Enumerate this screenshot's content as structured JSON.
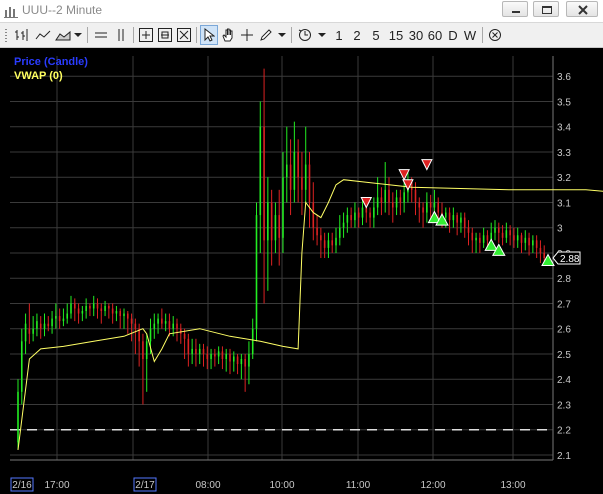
{
  "window": {
    "title": "UUU--2 Minute"
  },
  "toolbar": {
    "intervals": [
      "1",
      "2",
      "5",
      "15",
      "30",
      "60",
      "D",
      "W"
    ]
  },
  "legend": {
    "price": "Price (Candle)",
    "vwap": "VWAP (0)"
  },
  "colors": {
    "up": "#22ee22",
    "down": "#dd2222",
    "vwap": "#ffff66",
    "buy": "#33ee33",
    "sell": "#dd2222",
    "background": "#000000",
    "grid": "#3a3a3a"
  },
  "chart_data": {
    "type": "candlestick",
    "ylim": [
      2.08,
      3.68
    ],
    "y_ticks": [
      "3.6",
      "3.5",
      "3.4",
      "3.3",
      "3.2",
      "3.1",
      "3",
      "2.9",
      "2.8",
      "2.7",
      "2.6",
      "2.5",
      "2.4",
      "2.3",
      "2.2",
      "2.1"
    ],
    "x_ticks": [
      "2/16",
      "17:00",
      "2/17",
      "08:00",
      "10:00",
      "11:00",
      "12:00",
      "13:00"
    ],
    "last_price": "2.88",
    "reference_line": 2.2,
    "vwap": [
      [
        0,
        2.12
      ],
      [
        3,
        2.48
      ],
      [
        6,
        2.52
      ],
      [
        12,
        2.53
      ],
      [
        20,
        2.55
      ],
      [
        28,
        2.57
      ],
      [
        33,
        2.6
      ],
      [
        34,
        2.58
      ],
      [
        36,
        2.47
      ],
      [
        38,
        2.52
      ],
      [
        40,
        2.58
      ],
      [
        48,
        2.6
      ],
      [
        56,
        2.57
      ],
      [
        64,
        2.55
      ],
      [
        70,
        2.53
      ],
      [
        74,
        2.52
      ],
      [
        75,
        2.9
      ],
      [
        76,
        3.1
      ],
      [
        78,
        3.06
      ],
      [
        80,
        3.04
      ],
      [
        82,
        3.1
      ],
      [
        84,
        3.17
      ],
      [
        86,
        3.19
      ],
      [
        92,
        3.18
      ],
      [
        104,
        3.16
      ],
      [
        130,
        3.15
      ],
      [
        150,
        3.15
      ],
      [
        158,
        3.14
      ]
    ],
    "candles": [
      [
        0,
        2.15,
        2.35,
        2.12,
        2.4
      ],
      [
        1,
        2.35,
        2.55,
        2.3,
        2.6
      ],
      [
        2,
        2.55,
        2.62,
        2.5,
        2.66
      ],
      [
        3,
        2.6,
        2.58,
        2.54,
        2.7
      ],
      [
        4,
        2.58,
        2.6,
        2.55,
        2.65
      ],
      [
        5,
        2.6,
        2.63,
        2.57,
        2.66
      ],
      [
        6,
        2.62,
        2.6,
        2.56,
        2.65
      ],
      [
        7,
        2.6,
        2.62,
        2.57,
        2.66
      ],
      [
        8,
        2.62,
        2.61,
        2.59,
        2.65
      ],
      [
        9,
        2.61,
        2.64,
        2.58,
        2.67
      ],
      [
        10,
        2.64,
        2.65,
        2.6,
        2.7
      ],
      [
        11,
        2.65,
        2.63,
        2.6,
        2.68
      ],
      [
        12,
        2.63,
        2.64,
        2.61,
        2.68
      ],
      [
        13,
        2.64,
        2.66,
        2.62,
        2.7
      ],
      [
        14,
        2.66,
        2.7,
        2.64,
        2.73
      ],
      [
        15,
        2.7,
        2.68,
        2.63,
        2.72
      ],
      [
        16,
        2.68,
        2.66,
        2.62,
        2.7
      ],
      [
        17,
        2.66,
        2.67,
        2.63,
        2.69
      ],
      [
        18,
        2.67,
        2.69,
        2.64,
        2.72
      ],
      [
        19,
        2.69,
        2.68,
        2.65,
        2.7
      ],
      [
        20,
        2.68,
        2.7,
        2.65,
        2.73
      ],
      [
        21,
        2.7,
        2.68,
        2.64,
        2.72
      ],
      [
        22,
        2.68,
        2.67,
        2.62,
        2.7
      ],
      [
        23,
        2.67,
        2.69,
        2.65,
        2.71
      ],
      [
        24,
        2.69,
        2.68,
        2.64,
        2.7
      ],
      [
        25,
        2.68,
        2.66,
        2.62,
        2.7
      ],
      [
        26,
        2.66,
        2.67,
        2.63,
        2.69
      ],
      [
        27,
        2.67,
        2.65,
        2.6,
        2.68
      ],
      [
        28,
        2.65,
        2.66,
        2.6,
        2.68
      ],
      [
        29,
        2.66,
        2.64,
        2.58,
        2.67
      ],
      [
        30,
        2.64,
        2.62,
        2.55,
        2.66
      ],
      [
        31,
        2.62,
        2.6,
        2.5,
        2.64
      ],
      [
        32,
        2.6,
        2.55,
        2.45,
        2.62
      ],
      [
        33,
        2.55,
        2.48,
        2.3,
        2.58
      ],
      [
        34,
        2.48,
        2.55,
        2.35,
        2.58
      ],
      [
        35,
        2.55,
        2.6,
        2.5,
        2.64
      ],
      [
        36,
        2.6,
        2.62,
        2.56,
        2.66
      ],
      [
        37,
        2.62,
        2.64,
        2.58,
        2.66
      ],
      [
        38,
        2.64,
        2.62,
        2.6,
        2.68
      ],
      [
        39,
        2.62,
        2.63,
        2.59,
        2.66
      ],
      [
        40,
        2.63,
        2.6,
        2.57,
        2.66
      ],
      [
        41,
        2.6,
        2.62,
        2.57,
        2.65
      ],
      [
        42,
        2.62,
        2.6,
        2.55,
        2.64
      ],
      [
        43,
        2.6,
        2.58,
        2.54,
        2.62
      ],
      [
        44,
        2.58,
        2.56,
        2.48,
        2.6
      ],
      [
        45,
        2.56,
        2.5,
        2.45,
        2.58
      ],
      [
        46,
        2.5,
        2.52,
        2.46,
        2.56
      ],
      [
        47,
        2.52,
        2.5,
        2.45,
        2.56
      ],
      [
        48,
        2.5,
        2.52,
        2.46,
        2.54
      ],
      [
        49,
        2.52,
        2.5,
        2.45,
        2.54
      ],
      [
        50,
        2.5,
        2.48,
        2.44,
        2.53
      ],
      [
        51,
        2.48,
        2.5,
        2.44,
        2.52
      ],
      [
        52,
        2.5,
        2.49,
        2.45,
        2.52
      ],
      [
        53,
        2.49,
        2.51,
        2.46,
        2.53
      ],
      [
        54,
        2.51,
        2.48,
        2.44,
        2.53
      ],
      [
        55,
        2.48,
        2.5,
        2.43,
        2.52
      ],
      [
        56,
        2.5,
        2.47,
        2.42,
        2.52
      ],
      [
        57,
        2.47,
        2.49,
        2.43,
        2.51
      ],
      [
        58,
        2.49,
        2.46,
        2.42,
        2.5
      ],
      [
        59,
        2.46,
        2.48,
        2.4,
        2.5
      ],
      [
        60,
        2.48,
        2.45,
        2.35,
        2.5
      ],
      [
        61,
        2.45,
        2.5,
        2.38,
        2.55
      ],
      [
        62,
        2.5,
        2.6,
        2.48,
        2.64
      ],
      [
        63,
        2.6,
        3.05,
        2.55,
        3.1
      ],
      [
        64,
        3.05,
        3.4,
        2.9,
        3.5
      ],
      [
        65,
        3.4,
        2.95,
        2.7,
        3.63
      ],
      [
        66,
        2.95,
        3.1,
        2.75,
        3.2
      ],
      [
        67,
        3.1,
        2.95,
        2.85,
        3.15
      ],
      [
        68,
        2.95,
        3.05,
        2.9,
        3.1
      ],
      [
        69,
        3.05,
        2.96,
        2.85,
        3.15
      ],
      [
        70,
        2.96,
        3.2,
        2.9,
        3.3
      ],
      [
        71,
        3.2,
        3.25,
        3.1,
        3.4
      ],
      [
        72,
        3.25,
        3.15,
        3.05,
        3.35
      ],
      [
        73,
        3.15,
        3.3,
        3.1,
        3.42
      ],
      [
        74,
        3.3,
        3.2,
        3.1,
        3.35
      ],
      [
        75,
        3.2,
        3.15,
        3.05,
        3.3
      ],
      [
        76,
        3.15,
        3.25,
        3.1,
        3.4
      ],
      [
        77,
        3.25,
        3.1,
        3.0,
        3.3
      ],
      [
        78,
        3.1,
        3.0,
        2.95,
        3.18
      ],
      [
        79,
        3.0,
        2.97,
        2.93,
        3.05
      ],
      [
        80,
        2.97,
        2.95,
        2.88,
        3.0
      ],
      [
        81,
        2.95,
        2.92,
        2.88,
        2.98
      ],
      [
        82,
        2.92,
        2.95,
        2.88,
        2.98
      ],
      [
        83,
        2.95,
        2.93,
        2.9,
        2.98
      ],
      [
        84,
        2.93,
        2.96,
        2.9,
        3.0
      ],
      [
        85,
        2.96,
        3.0,
        2.93,
        3.05
      ],
      [
        86,
        3.0,
        3.02,
        2.96,
        3.06
      ],
      [
        87,
        3.02,
        3.05,
        2.98,
        3.08
      ],
      [
        88,
        3.05,
        3.03,
        3.0,
        3.08
      ],
      [
        89,
        3.03,
        3.06,
        3.0,
        3.1
      ],
      [
        90,
        3.06,
        3.04,
        3.0,
        3.08
      ],
      [
        91,
        3.04,
        3.08,
        3.01,
        3.12
      ],
      [
        92,
        3.08,
        3.06,
        3.02,
        3.1
      ],
      [
        93,
        3.06,
        3.04,
        3.0,
        3.08
      ],
      [
        94,
        3.04,
        3.08,
        3.0,
        3.12
      ],
      [
        95,
        3.08,
        3.12,
        3.05,
        3.2
      ],
      [
        96,
        3.12,
        3.1,
        3.05,
        3.16
      ],
      [
        97,
        3.1,
        3.15,
        3.06,
        3.26
      ],
      [
        98,
        3.15,
        3.1,
        3.05,
        3.2
      ],
      [
        99,
        3.1,
        3.08,
        3.02,
        3.14
      ],
      [
        100,
        3.08,
        3.12,
        3.05,
        3.15
      ],
      [
        101,
        3.12,
        3.1,
        3.05,
        3.15
      ],
      [
        102,
        3.1,
        3.14,
        3.06,
        3.2
      ],
      [
        103,
        3.14,
        3.18,
        3.1,
        3.22
      ],
      [
        104,
        3.18,
        3.15,
        3.1,
        3.2
      ],
      [
        105,
        3.15,
        3.1,
        3.05,
        3.18
      ],
      [
        106,
        3.1,
        3.08,
        3.02,
        3.12
      ],
      [
        107,
        3.08,
        3.06,
        3.0,
        3.1
      ],
      [
        108,
        3.06,
        3.1,
        3.02,
        3.14
      ],
      [
        109,
        3.1,
        3.08,
        3.04,
        3.13
      ],
      [
        110,
        3.08,
        3.1,
        3.05,
        3.15
      ],
      [
        111,
        3.1,
        3.06,
        3.02,
        3.12
      ],
      [
        112,
        3.06,
        3.04,
        3.0,
        3.1
      ],
      [
        113,
        3.04,
        3.06,
        3.0,
        3.08
      ],
      [
        114,
        3.06,
        3.03,
        2.98,
        3.08
      ],
      [
        115,
        3.03,
        3.05,
        3.0,
        3.08
      ],
      [
        116,
        3.05,
        3.02,
        2.97,
        3.06
      ],
      [
        117,
        3.02,
        3.04,
        2.98,
        3.06
      ],
      [
        118,
        3.04,
        3.0,
        2.96,
        3.06
      ],
      [
        119,
        3.0,
        2.98,
        2.93,
        3.03
      ],
      [
        120,
        2.98,
        2.95,
        2.9,
        3.0
      ],
      [
        121,
        2.95,
        2.96,
        2.9,
        2.98
      ],
      [
        122,
        2.96,
        2.94,
        2.9,
        2.98
      ],
      [
        123,
        2.94,
        2.97,
        2.92,
        3.0
      ],
      [
        124,
        2.97,
        2.95,
        2.92,
        2.99
      ],
      [
        125,
        2.95,
        2.98,
        2.93,
        3.02
      ],
      [
        126,
        2.98,
        3.0,
        2.95,
        3.03
      ],
      [
        127,
        3.0,
        2.98,
        2.94,
        3.02
      ],
      [
        128,
        2.98,
        2.96,
        2.93,
        3.01
      ],
      [
        129,
        2.96,
        2.99,
        2.94,
        3.02
      ],
      [
        130,
        2.99,
        2.97,
        2.93,
        3.01
      ],
      [
        131,
        2.97,
        2.95,
        2.92,
        3.0
      ],
      [
        132,
        2.95,
        2.97,
        2.92,
        3.0
      ],
      [
        133,
        2.97,
        2.94,
        2.9,
        2.98
      ],
      [
        134,
        2.94,
        2.96,
        2.91,
        2.99
      ],
      [
        135,
        2.96,
        2.93,
        2.89,
        2.98
      ],
      [
        136,
        2.93,
        2.95,
        2.9,
        2.97
      ],
      [
        137,
        2.95,
        2.92,
        2.88,
        2.97
      ],
      [
        138,
        2.92,
        2.9,
        2.86,
        2.95
      ],
      [
        139,
        2.9,
        2.88,
        2.85,
        2.93
      ]
    ],
    "signals": [
      {
        "type": "sell",
        "i": 92,
        "y": 3.1
      },
      {
        "type": "sell",
        "i": 102,
        "y": 3.21
      },
      {
        "type": "sell",
        "i": 103,
        "y": 3.17
      },
      {
        "type": "sell",
        "i": 108,
        "y": 3.25
      },
      {
        "type": "buy",
        "i": 110,
        "y": 3.04
      },
      {
        "type": "buy",
        "i": 112,
        "y": 3.03
      },
      {
        "type": "buy",
        "i": 125,
        "y": 2.93
      },
      {
        "type": "buy",
        "i": 127,
        "y": 2.91
      },
      {
        "type": "buy",
        "i": 140,
        "y": 2.87
      }
    ]
  }
}
